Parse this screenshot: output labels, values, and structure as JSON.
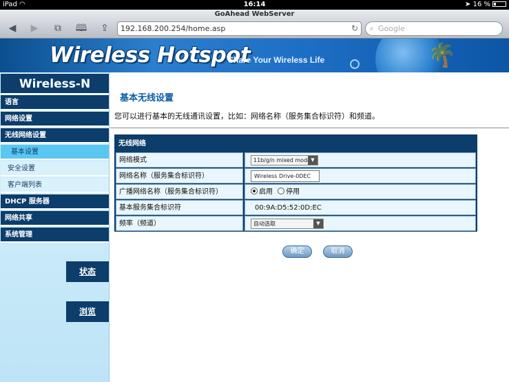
{
  "status_bar": {
    "device": "iPad",
    "time": "16:14",
    "battery": "16 %"
  },
  "browser": {
    "title": "GoAhead WebServer",
    "url": "192.168.200.254/home.asp",
    "search_placeholder": "Google"
  },
  "banner": {
    "title": "Wireless Hotspot",
    "tagline": "Share Your Wireless Life"
  },
  "sidebar": {
    "brand": "Wireless-N",
    "items": [
      {
        "label": "语言",
        "type": "main"
      },
      {
        "label": "网络设置",
        "type": "main"
      },
      {
        "label": "无线网络设置",
        "type": "main"
      },
      {
        "label": "基本设置",
        "type": "sub-active"
      },
      {
        "label": "安全设置",
        "type": "sub"
      },
      {
        "label": "客户端列表",
        "type": "sub"
      },
      {
        "label": "DHCP 服务器",
        "type": "main"
      },
      {
        "label": "网络共享",
        "type": "main"
      },
      {
        "label": "系统管理",
        "type": "main"
      }
    ],
    "status_button": "状态",
    "browse_button": "浏览"
  },
  "content": {
    "title": "基本无线设置",
    "description": "您可以进行基本的无线通讯设置，比如：网络名称（服务集合标识符）和频道。",
    "panel_title": "无线网络",
    "rows": {
      "mode_label": "网络模式",
      "mode_value": "11b/g/n mixed mode",
      "ssid_label": "网络名称（服务集合标识符）",
      "ssid_value": "Wireless Drive-0DEC",
      "broadcast_label": "广播网络名称（服务集合标识符）",
      "broadcast_on": "启用",
      "broadcast_off": "停用",
      "bssid_label": "基本服务集合标识符",
      "bssid_value": "00:9A:D5:52:0D:EC",
      "channel_label": "频率（频道）",
      "channel_value": "自动选取"
    },
    "ok_button": "确定",
    "cancel_button": "取消"
  }
}
